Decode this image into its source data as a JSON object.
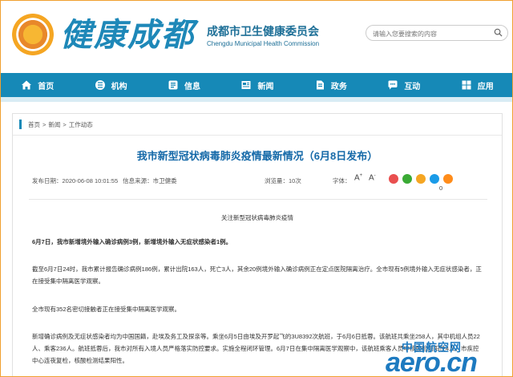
{
  "header": {
    "logo_text": "健康成都",
    "org_name_cn": "成都市卫生健康委员会",
    "org_name_en": "Chengdu Municipal Health Commission",
    "search_placeholder": "请输入您要搜索的内容"
  },
  "nav": {
    "items": [
      {
        "label": "首页",
        "icon": "home-icon"
      },
      {
        "label": "机构",
        "icon": "org-icon"
      },
      {
        "label": "信息",
        "icon": "info-icon"
      },
      {
        "label": "新闻",
        "icon": "news-icon"
      },
      {
        "label": "政务",
        "icon": "gov-icon"
      },
      {
        "label": "互动",
        "icon": "chat-icon"
      },
      {
        "label": "应用",
        "icon": "apps-icon"
      }
    ]
  },
  "breadcrumb": {
    "items": [
      "首页",
      "新闻",
      "工作动态"
    ],
    "separator": ">"
  },
  "article": {
    "title": "我市新型冠状病毒肺炎疫情最新情况（6月8日发布）",
    "publish_time": "发布日期：2020-06-08 10:01:55",
    "source": "信息来源：市卫健委",
    "views": "浏览量：10次",
    "font_label": "字体：",
    "font_up": "A",
    "font_down": "A",
    "share_count": "0",
    "subtitle": "关注新型冠状病毒肺炎疫情",
    "p1": "6月7日，我市新增境外输入确诊病例3例，新增境外输入无症状感染者1例。",
    "p2": "截至6月7日24时，我市累计报告确诊病例186例，累计出院163人，死亡3人，其余20例境外输入确诊病例正在定点医院隔离治疗。全市现有5例境外输入无症状感染者，正在接受集中隔离医学观察。",
    "p3": "全市现有352名密切接触者正在接受集中隔离医学观察。",
    "p4": "新增确诊病例及无症状感染者均为中国国籍，赴埃及务工及探亲等。乘坐6月5日由埃及开罗起飞的3U8392次航班，于6月6日抵蓉。该航班共乘坐258人，其中机组人员22人、乘客236人。航班抵蓉后，我市对所有入境人员严格落实防控要求。实施全程闭环管理。6月7日在集中隔离医学观察中，该航班乘客人员中核酸检测阳性4人，市疾控中心连夜复检，核酸检测结果阳性。"
  },
  "watermark": {
    "cn": "中国航空网",
    "en": "aero.cn"
  },
  "colors": {
    "nav_bg": "#1689b7",
    "title": "#1569a8",
    "frame_border": "#f0a030"
  }
}
